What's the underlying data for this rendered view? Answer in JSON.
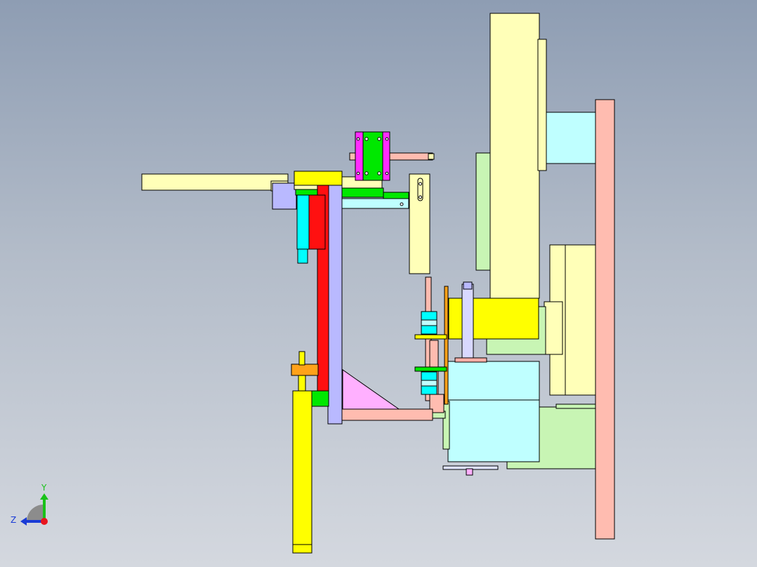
{
  "viewport": {
    "background_top": "#8e9db3",
    "background_bottom": "#d4d8df"
  },
  "triad": {
    "y_label": "Y",
    "z_label": "Z",
    "y_color": "#19c219",
    "z_color": "#1a3bd6",
    "origin_color": "#e8141e"
  },
  "palette": {
    "pale_yellow": "#ffffb8",
    "yellow": "#ffff00",
    "red": "#ff1010",
    "cyan": "#00ffff",
    "light_cyan": "#bfffff",
    "green": "#00e800",
    "light_green": "#c8f5b4",
    "salmon": "#ffbcb0",
    "lavender": "#b9b9ff",
    "magenta": "#ff2cff",
    "pink": "#ffb0ff",
    "orange": "#ffa21a",
    "outline": "#000000"
  }
}
